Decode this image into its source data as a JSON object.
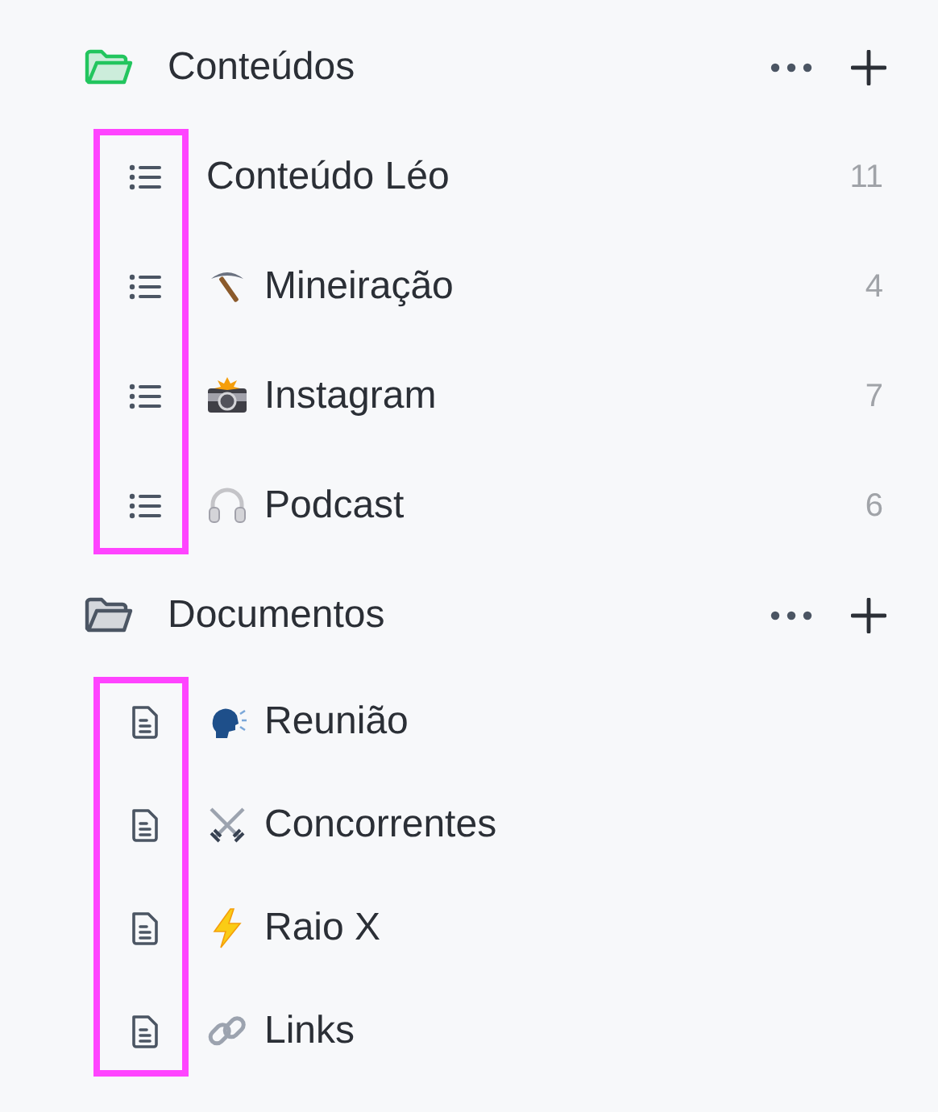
{
  "sections": [
    {
      "title": "Conteúdos",
      "color": "#22c55e",
      "kind": "list",
      "highlighted": true,
      "items": [
        {
          "title": "Conteúdo Léo",
          "count": "11"
        },
        {
          "title": "Mineiração",
          "kind": "pickaxe",
          "count": "4"
        },
        {
          "title": "Instagram",
          "kind": "camera",
          "count": "7"
        },
        {
          "title": "Podcast",
          "kind": "headphones",
          "count": "6"
        }
      ]
    },
    {
      "title": "Documentos",
      "color": "#4b5563",
      "kind": "document",
      "highlighted": true,
      "items": [
        {
          "title": "Reunião",
          "kind": "speaking-head"
        },
        {
          "title": "Concorrentes",
          "kind": "swords"
        },
        {
          "title": "Raio X",
          "kind": "lightning"
        },
        {
          "title": "Links",
          "kind": "link"
        }
      ]
    }
  ]
}
